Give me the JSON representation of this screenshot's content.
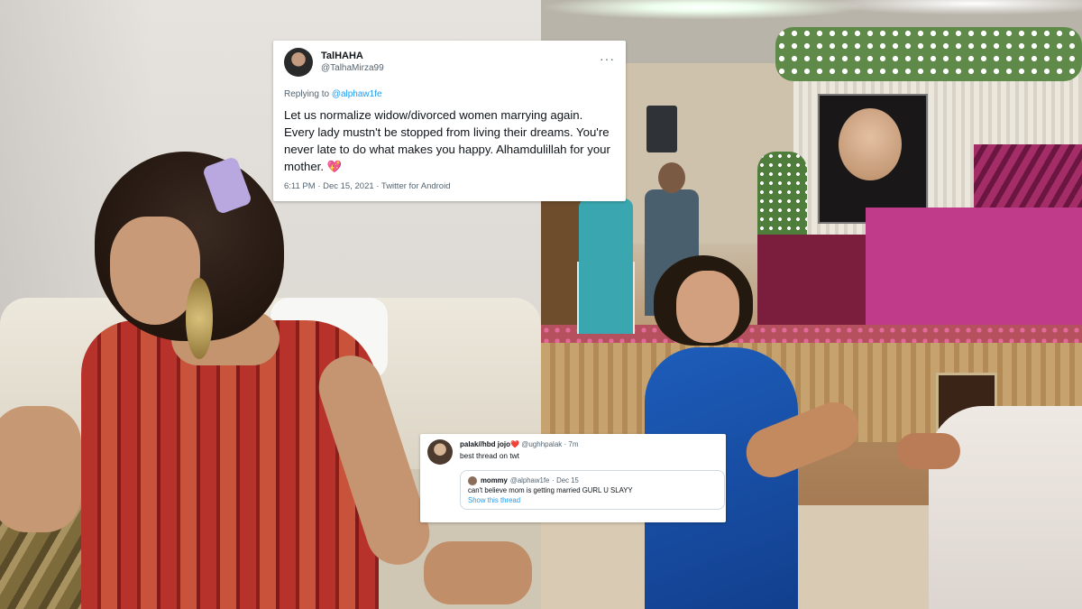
{
  "tweet_main": {
    "display_name": "TalHAHA",
    "handle": "@TalhaMirza99",
    "more_icon": "···",
    "replying_prefix": "Replying to",
    "replying_to": "@alphaw1fe",
    "body": "Let us normalize widow/divorced women marrying again. Every lady mustn't be stopped from living their dreams. You're never late to do what makes you happy. Alhamdulillah for your mother.",
    "heart_emoji": "💖",
    "timestamp": "6:11 PM · Dec 15, 2021",
    "source": "Twitter for Android"
  },
  "tweet_quote": {
    "display_name": "palak//hbd jojo",
    "name_emoji": "❤️",
    "handle": "@ughhpalak",
    "age": "· 7m",
    "text": "best thread on twt",
    "quoted": {
      "display_name": "mommy",
      "handle": "@alphaw1fe",
      "date": "· Dec 15",
      "text": "can't believe mom is getting married GURL U SLAYY",
      "show_thread": "Show this thread"
    }
  },
  "colors": {
    "link_blue": "#1d9bf0",
    "secondary_text": "#536471",
    "primary_text": "#0f1419"
  }
}
